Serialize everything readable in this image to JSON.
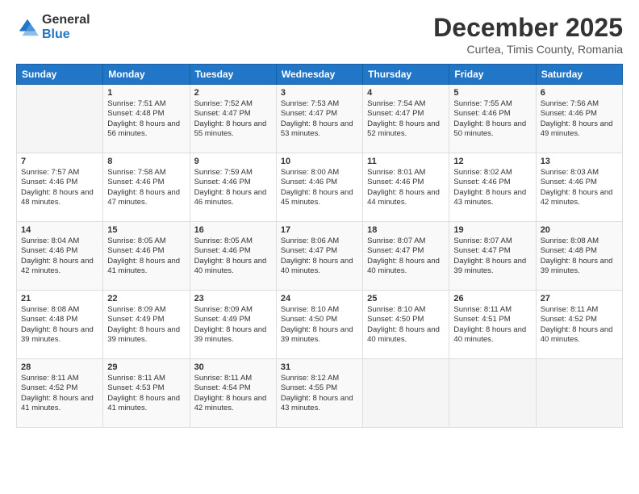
{
  "logo": {
    "general": "General",
    "blue": "Blue"
  },
  "header": {
    "title": "December 2025",
    "subtitle": "Curtea, Timis County, Romania"
  },
  "weekdays": [
    "Sunday",
    "Monday",
    "Tuesday",
    "Wednesday",
    "Thursday",
    "Friday",
    "Saturday"
  ],
  "weeks": [
    [
      {
        "day": "",
        "sunrise": "",
        "sunset": "",
        "daylight": ""
      },
      {
        "day": "1",
        "sunrise": "Sunrise: 7:51 AM",
        "sunset": "Sunset: 4:48 PM",
        "daylight": "Daylight: 8 hours and 56 minutes."
      },
      {
        "day": "2",
        "sunrise": "Sunrise: 7:52 AM",
        "sunset": "Sunset: 4:47 PM",
        "daylight": "Daylight: 8 hours and 55 minutes."
      },
      {
        "day": "3",
        "sunrise": "Sunrise: 7:53 AM",
        "sunset": "Sunset: 4:47 PM",
        "daylight": "Daylight: 8 hours and 53 minutes."
      },
      {
        "day": "4",
        "sunrise": "Sunrise: 7:54 AM",
        "sunset": "Sunset: 4:47 PM",
        "daylight": "Daylight: 8 hours and 52 minutes."
      },
      {
        "day": "5",
        "sunrise": "Sunrise: 7:55 AM",
        "sunset": "Sunset: 4:46 PM",
        "daylight": "Daylight: 8 hours and 50 minutes."
      },
      {
        "day": "6",
        "sunrise": "Sunrise: 7:56 AM",
        "sunset": "Sunset: 4:46 PM",
        "daylight": "Daylight: 8 hours and 49 minutes."
      }
    ],
    [
      {
        "day": "7",
        "sunrise": "Sunrise: 7:57 AM",
        "sunset": "Sunset: 4:46 PM",
        "daylight": "Daylight: 8 hours and 48 minutes."
      },
      {
        "day": "8",
        "sunrise": "Sunrise: 7:58 AM",
        "sunset": "Sunset: 4:46 PM",
        "daylight": "Daylight: 8 hours and 47 minutes."
      },
      {
        "day": "9",
        "sunrise": "Sunrise: 7:59 AM",
        "sunset": "Sunset: 4:46 PM",
        "daylight": "Daylight: 8 hours and 46 minutes."
      },
      {
        "day": "10",
        "sunrise": "Sunrise: 8:00 AM",
        "sunset": "Sunset: 4:46 PM",
        "daylight": "Daylight: 8 hours and 45 minutes."
      },
      {
        "day": "11",
        "sunrise": "Sunrise: 8:01 AM",
        "sunset": "Sunset: 4:46 PM",
        "daylight": "Daylight: 8 hours and 44 minutes."
      },
      {
        "day": "12",
        "sunrise": "Sunrise: 8:02 AM",
        "sunset": "Sunset: 4:46 PM",
        "daylight": "Daylight: 8 hours and 43 minutes."
      },
      {
        "day": "13",
        "sunrise": "Sunrise: 8:03 AM",
        "sunset": "Sunset: 4:46 PM",
        "daylight": "Daylight: 8 hours and 42 minutes."
      }
    ],
    [
      {
        "day": "14",
        "sunrise": "Sunrise: 8:04 AM",
        "sunset": "Sunset: 4:46 PM",
        "daylight": "Daylight: 8 hours and 42 minutes."
      },
      {
        "day": "15",
        "sunrise": "Sunrise: 8:05 AM",
        "sunset": "Sunset: 4:46 PM",
        "daylight": "Daylight: 8 hours and 41 minutes."
      },
      {
        "day": "16",
        "sunrise": "Sunrise: 8:05 AM",
        "sunset": "Sunset: 4:46 PM",
        "daylight": "Daylight: 8 hours and 40 minutes."
      },
      {
        "day": "17",
        "sunrise": "Sunrise: 8:06 AM",
        "sunset": "Sunset: 4:47 PM",
        "daylight": "Daylight: 8 hours and 40 minutes."
      },
      {
        "day": "18",
        "sunrise": "Sunrise: 8:07 AM",
        "sunset": "Sunset: 4:47 PM",
        "daylight": "Daylight: 8 hours and 40 minutes."
      },
      {
        "day": "19",
        "sunrise": "Sunrise: 8:07 AM",
        "sunset": "Sunset: 4:47 PM",
        "daylight": "Daylight: 8 hours and 39 minutes."
      },
      {
        "day": "20",
        "sunrise": "Sunrise: 8:08 AM",
        "sunset": "Sunset: 4:48 PM",
        "daylight": "Daylight: 8 hours and 39 minutes."
      }
    ],
    [
      {
        "day": "21",
        "sunrise": "Sunrise: 8:08 AM",
        "sunset": "Sunset: 4:48 PM",
        "daylight": "Daylight: 8 hours and 39 minutes."
      },
      {
        "day": "22",
        "sunrise": "Sunrise: 8:09 AM",
        "sunset": "Sunset: 4:49 PM",
        "daylight": "Daylight: 8 hours and 39 minutes."
      },
      {
        "day": "23",
        "sunrise": "Sunrise: 8:09 AM",
        "sunset": "Sunset: 4:49 PM",
        "daylight": "Daylight: 8 hours and 39 minutes."
      },
      {
        "day": "24",
        "sunrise": "Sunrise: 8:10 AM",
        "sunset": "Sunset: 4:50 PM",
        "daylight": "Daylight: 8 hours and 39 minutes."
      },
      {
        "day": "25",
        "sunrise": "Sunrise: 8:10 AM",
        "sunset": "Sunset: 4:50 PM",
        "daylight": "Daylight: 8 hours and 40 minutes."
      },
      {
        "day": "26",
        "sunrise": "Sunrise: 8:11 AM",
        "sunset": "Sunset: 4:51 PM",
        "daylight": "Daylight: 8 hours and 40 minutes."
      },
      {
        "day": "27",
        "sunrise": "Sunrise: 8:11 AM",
        "sunset": "Sunset: 4:52 PM",
        "daylight": "Daylight: 8 hours and 40 minutes."
      }
    ],
    [
      {
        "day": "28",
        "sunrise": "Sunrise: 8:11 AM",
        "sunset": "Sunset: 4:52 PM",
        "daylight": "Daylight: 8 hours and 41 minutes."
      },
      {
        "day": "29",
        "sunrise": "Sunrise: 8:11 AM",
        "sunset": "Sunset: 4:53 PM",
        "daylight": "Daylight: 8 hours and 41 minutes."
      },
      {
        "day": "30",
        "sunrise": "Sunrise: 8:11 AM",
        "sunset": "Sunset: 4:54 PM",
        "daylight": "Daylight: 8 hours and 42 minutes."
      },
      {
        "day": "31",
        "sunrise": "Sunrise: 8:12 AM",
        "sunset": "Sunset: 4:55 PM",
        "daylight": "Daylight: 8 hours and 43 minutes."
      },
      {
        "day": "",
        "sunrise": "",
        "sunset": "",
        "daylight": ""
      },
      {
        "day": "",
        "sunrise": "",
        "sunset": "",
        "daylight": ""
      },
      {
        "day": "",
        "sunrise": "",
        "sunset": "",
        "daylight": ""
      }
    ]
  ]
}
